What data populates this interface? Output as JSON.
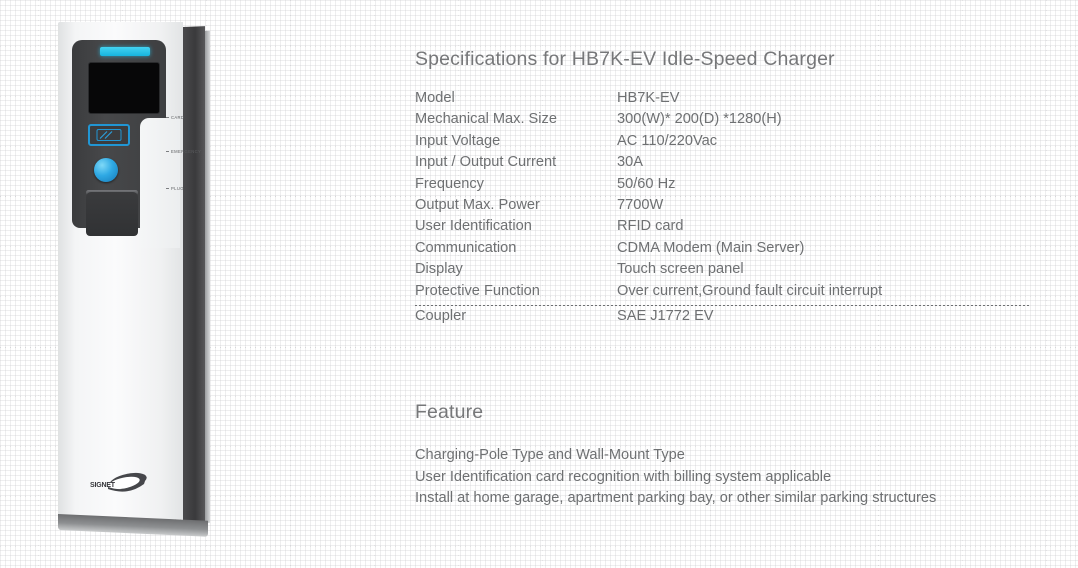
{
  "product_image": {
    "alt_name": "HB7K-EV idle-speed charging pole",
    "brand_logo_text": "SIGNET",
    "callouts": [
      {
        "label": "CARD"
      },
      {
        "label": "EMERGENCY"
      },
      {
        "label": "PLUG"
      }
    ],
    "colors": {
      "body": "#f4f5f6",
      "panel": "#434446",
      "led_strip": "#29c5e8",
      "screen": "#070708",
      "button": "#2fa9e4",
      "card_slot_border": "#2196d4",
      "side_face": "#3f4042"
    }
  },
  "specifications": {
    "title": "Specifications for HB7K-EV Idle-Speed Charger",
    "rows": [
      {
        "label": "Model",
        "value": "HB7K-EV"
      },
      {
        "label": "Mechanical Max. Size",
        "value": "300(W)* 200(D) *1280(H)"
      },
      {
        "label": "Input Voltage",
        "value": "AC 110/220Vac"
      },
      {
        "label": "Input / Output Current",
        "value": "30A"
      },
      {
        "label": "Frequency",
        "value": "50/60 Hz"
      },
      {
        "label": "Output Max. Power",
        "value": "7700W"
      },
      {
        "label": "User Identification",
        "value": "RFID card"
      },
      {
        "label": "Communication",
        "value": "CDMA Modem (Main Server)"
      },
      {
        "label": "Display",
        "value": "Touch screen panel"
      },
      {
        "label": "Protective Function",
        "value": "Over current,Ground fault circuit interrupt"
      }
    ],
    "footer_rows": [
      {
        "label": "Coupler",
        "value": "SAE J1772 EV"
      }
    ]
  },
  "feature": {
    "title": "Feature",
    "lines": [
      "Charging-Pole Type and Wall-Mount Type",
      "User Identification card recognition with billing system applicable",
      "Install at home garage, apartment parking bay, or other similar parking structures"
    ]
  },
  "text_color": "#6e7072"
}
